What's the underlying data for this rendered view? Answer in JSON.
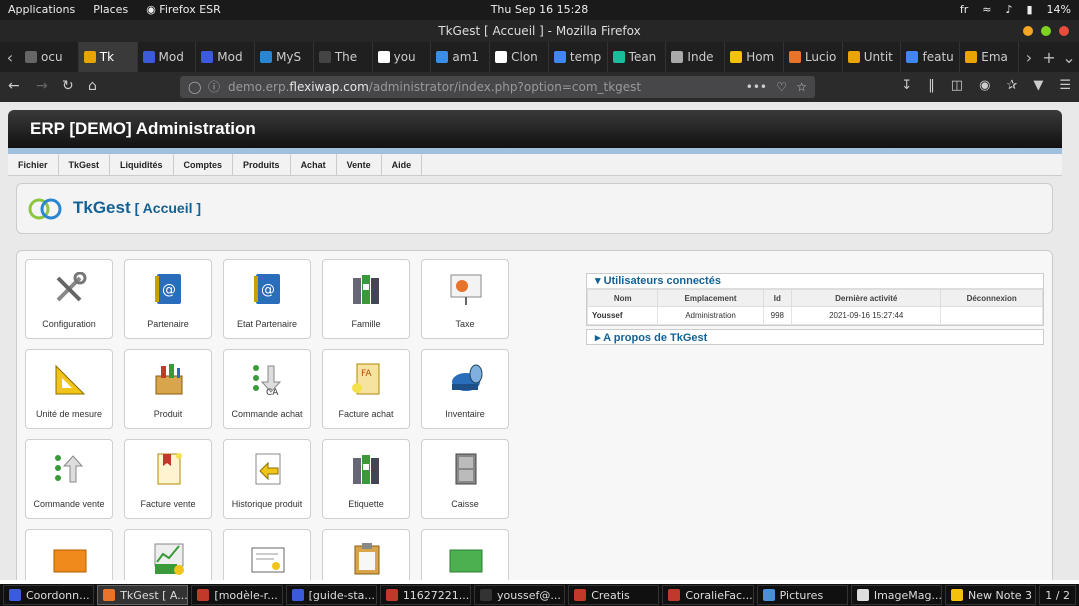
{
  "system": {
    "menu_applications": "Applications",
    "menu_places": "Places",
    "app_name": "Firefox ESR",
    "clock": "Thu Sep 16  15:28",
    "lang": "fr",
    "battery": "14%"
  },
  "window": {
    "title": "TkGest [ Accueil ] - Mozilla Firefox"
  },
  "tabs": [
    {
      "label": "ocu",
      "color": "#666"
    },
    {
      "label": "Tk",
      "color": "#e8a400",
      "active": true
    },
    {
      "label": "Mod",
      "color": "#3b5bdb"
    },
    {
      "label": "Mod",
      "color": "#3b5bdb"
    },
    {
      "label": "MyS",
      "color": "#2a86d1"
    },
    {
      "label": "The",
      "color": "#444"
    },
    {
      "label": "you",
      "color": "#fff"
    },
    {
      "label": "am1",
      "color": "#3a8ee6"
    },
    {
      "label": "Clon",
      "color": "#fff"
    },
    {
      "label": "temp",
      "color": "#4285f4"
    },
    {
      "label": "Tean",
      "color": "#1abc9c"
    },
    {
      "label": "Inde",
      "color": "#aaa"
    },
    {
      "label": "Hom",
      "color": "#f4c20d"
    },
    {
      "label": "Lucio",
      "color": "#e8742b"
    },
    {
      "label": "Untit",
      "color": "#e8a400"
    },
    {
      "label": "featu",
      "color": "#4285f4"
    },
    {
      "label": "Ema",
      "color": "#e8a400"
    }
  ],
  "url": {
    "prefix": "demo.erp.",
    "host": "flexiwap.com",
    "path": "/administrator/index.php?option=com_tkgest",
    "dots": "•••"
  },
  "admin": {
    "title": "ERP [DEMO] Administration"
  },
  "menubar": [
    "Fichier",
    "TkGest",
    "Liquidités",
    "Comptes",
    "Produits",
    "Achat",
    "Vente",
    "Aide"
  ],
  "page": {
    "title": "TkGest",
    "subtitle": "[ Accueil ]"
  },
  "cards": [
    {
      "label": "Configuration",
      "icon": "tools-icon"
    },
    {
      "label": "Partenaire",
      "icon": "addressbook-icon"
    },
    {
      "label": "Etat Partenaire",
      "icon": "addressbook-icon"
    },
    {
      "label": "Famille",
      "icon": "binders-icon"
    },
    {
      "label": "Taxe",
      "icon": "presentation-icon"
    },
    {
      "label": "Unité de mesure",
      "icon": "setsquare-icon"
    },
    {
      "label": "Produit",
      "icon": "box-icon"
    },
    {
      "label": "Commande achat",
      "icon": "order-in-icon"
    },
    {
      "label": "Facture achat",
      "icon": "invoice-in-icon"
    },
    {
      "label": "Inventaire",
      "icon": "barrel-icon"
    },
    {
      "label": "Commande vente",
      "icon": "order-out-icon"
    },
    {
      "label": "Facture vente",
      "icon": "invoice-out-icon"
    },
    {
      "label": "Historique produit",
      "icon": "history-icon"
    },
    {
      "label": "Etiquette",
      "icon": "binders-icon"
    },
    {
      "label": "Caisse",
      "icon": "cabinet-icon"
    },
    {
      "label": "",
      "icon": "orange-card-icon"
    },
    {
      "label": "",
      "icon": "chart-money-icon"
    },
    {
      "label": "",
      "icon": "certificate-icon"
    },
    {
      "label": "",
      "icon": "clipboard-icon"
    },
    {
      "label": "",
      "icon": "green-card-icon"
    }
  ],
  "users": {
    "heading": "Utilisateurs connectés",
    "columns": [
      "Nom",
      "Emplacement",
      "Id",
      "Dernière activité",
      "Déconnexion"
    ],
    "rows": [
      [
        "Youssef",
        "Administration",
        "998",
        "2021-09-16 15:27:44",
        ""
      ]
    ]
  },
  "about": "A propos de TkGest",
  "taskbar": [
    {
      "label": "Coordonn...",
      "color": "#3b5bdb"
    },
    {
      "label": "TkGest [ A...",
      "color": "#e8742b",
      "active": true
    },
    {
      "label": "[modèle-r...",
      "color": "#c0392b"
    },
    {
      "label": "[guide-sta...",
      "color": "#3b5bdb"
    },
    {
      "label": "11627221...",
      "color": "#c0392b"
    },
    {
      "label": "youssef@...",
      "color": "#333"
    },
    {
      "label": "Creatis",
      "color": "#c0392b"
    },
    {
      "label": "CoralieFac...",
      "color": "#c0392b"
    },
    {
      "label": "Pictures",
      "color": "#4a90d9"
    },
    {
      "label": "ImageMag...",
      "color": "#ddd"
    },
    {
      "label": "New Note 3",
      "color": "#f4c20d"
    }
  ],
  "workspace": "1 / 2"
}
